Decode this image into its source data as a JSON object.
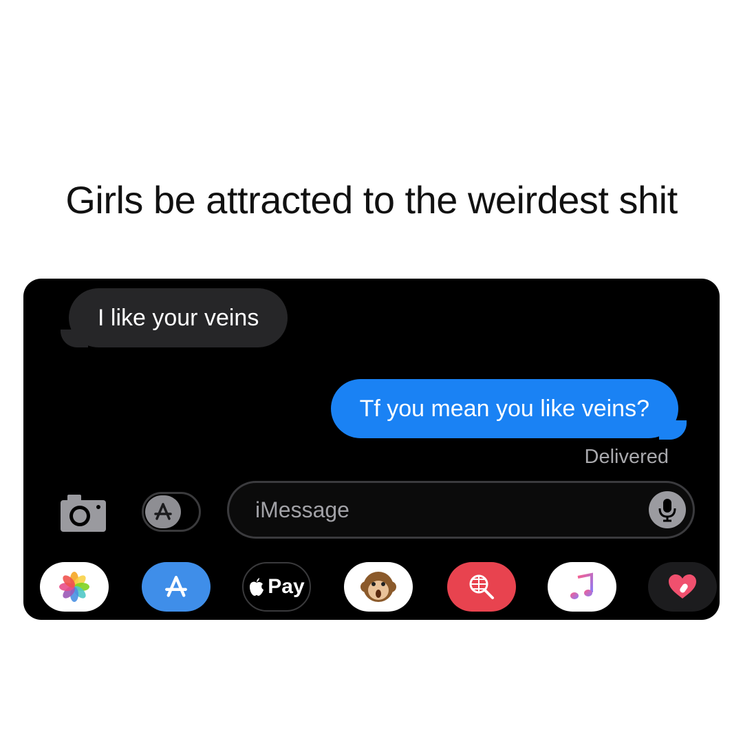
{
  "caption": "Girls be attracted to the weirdest shit",
  "messages": {
    "received": "I like your veins",
    "sent": "Tf you mean you like veins?",
    "status": "Delivered"
  },
  "composer": {
    "placeholder": "iMessage",
    "camera_icon": "camera-icon",
    "apps_icon": "app-store-icon",
    "mic_icon": "microphone-icon"
  },
  "app_drawer": {
    "items": [
      {
        "icon": "photos-icon"
      },
      {
        "icon": "app-store-icon"
      },
      {
        "icon": "apple-pay-icon",
        "label": "Pay"
      },
      {
        "icon": "animoji-monkey-icon"
      },
      {
        "icon": "images-search-icon"
      },
      {
        "icon": "music-icon"
      },
      {
        "icon": "digital-touch-heart-icon"
      }
    ]
  },
  "colors": {
    "background": "#000000",
    "sent_bubble": "#1a82f4",
    "received_bubble": "#262628",
    "status_text": "#a9a9ad"
  }
}
